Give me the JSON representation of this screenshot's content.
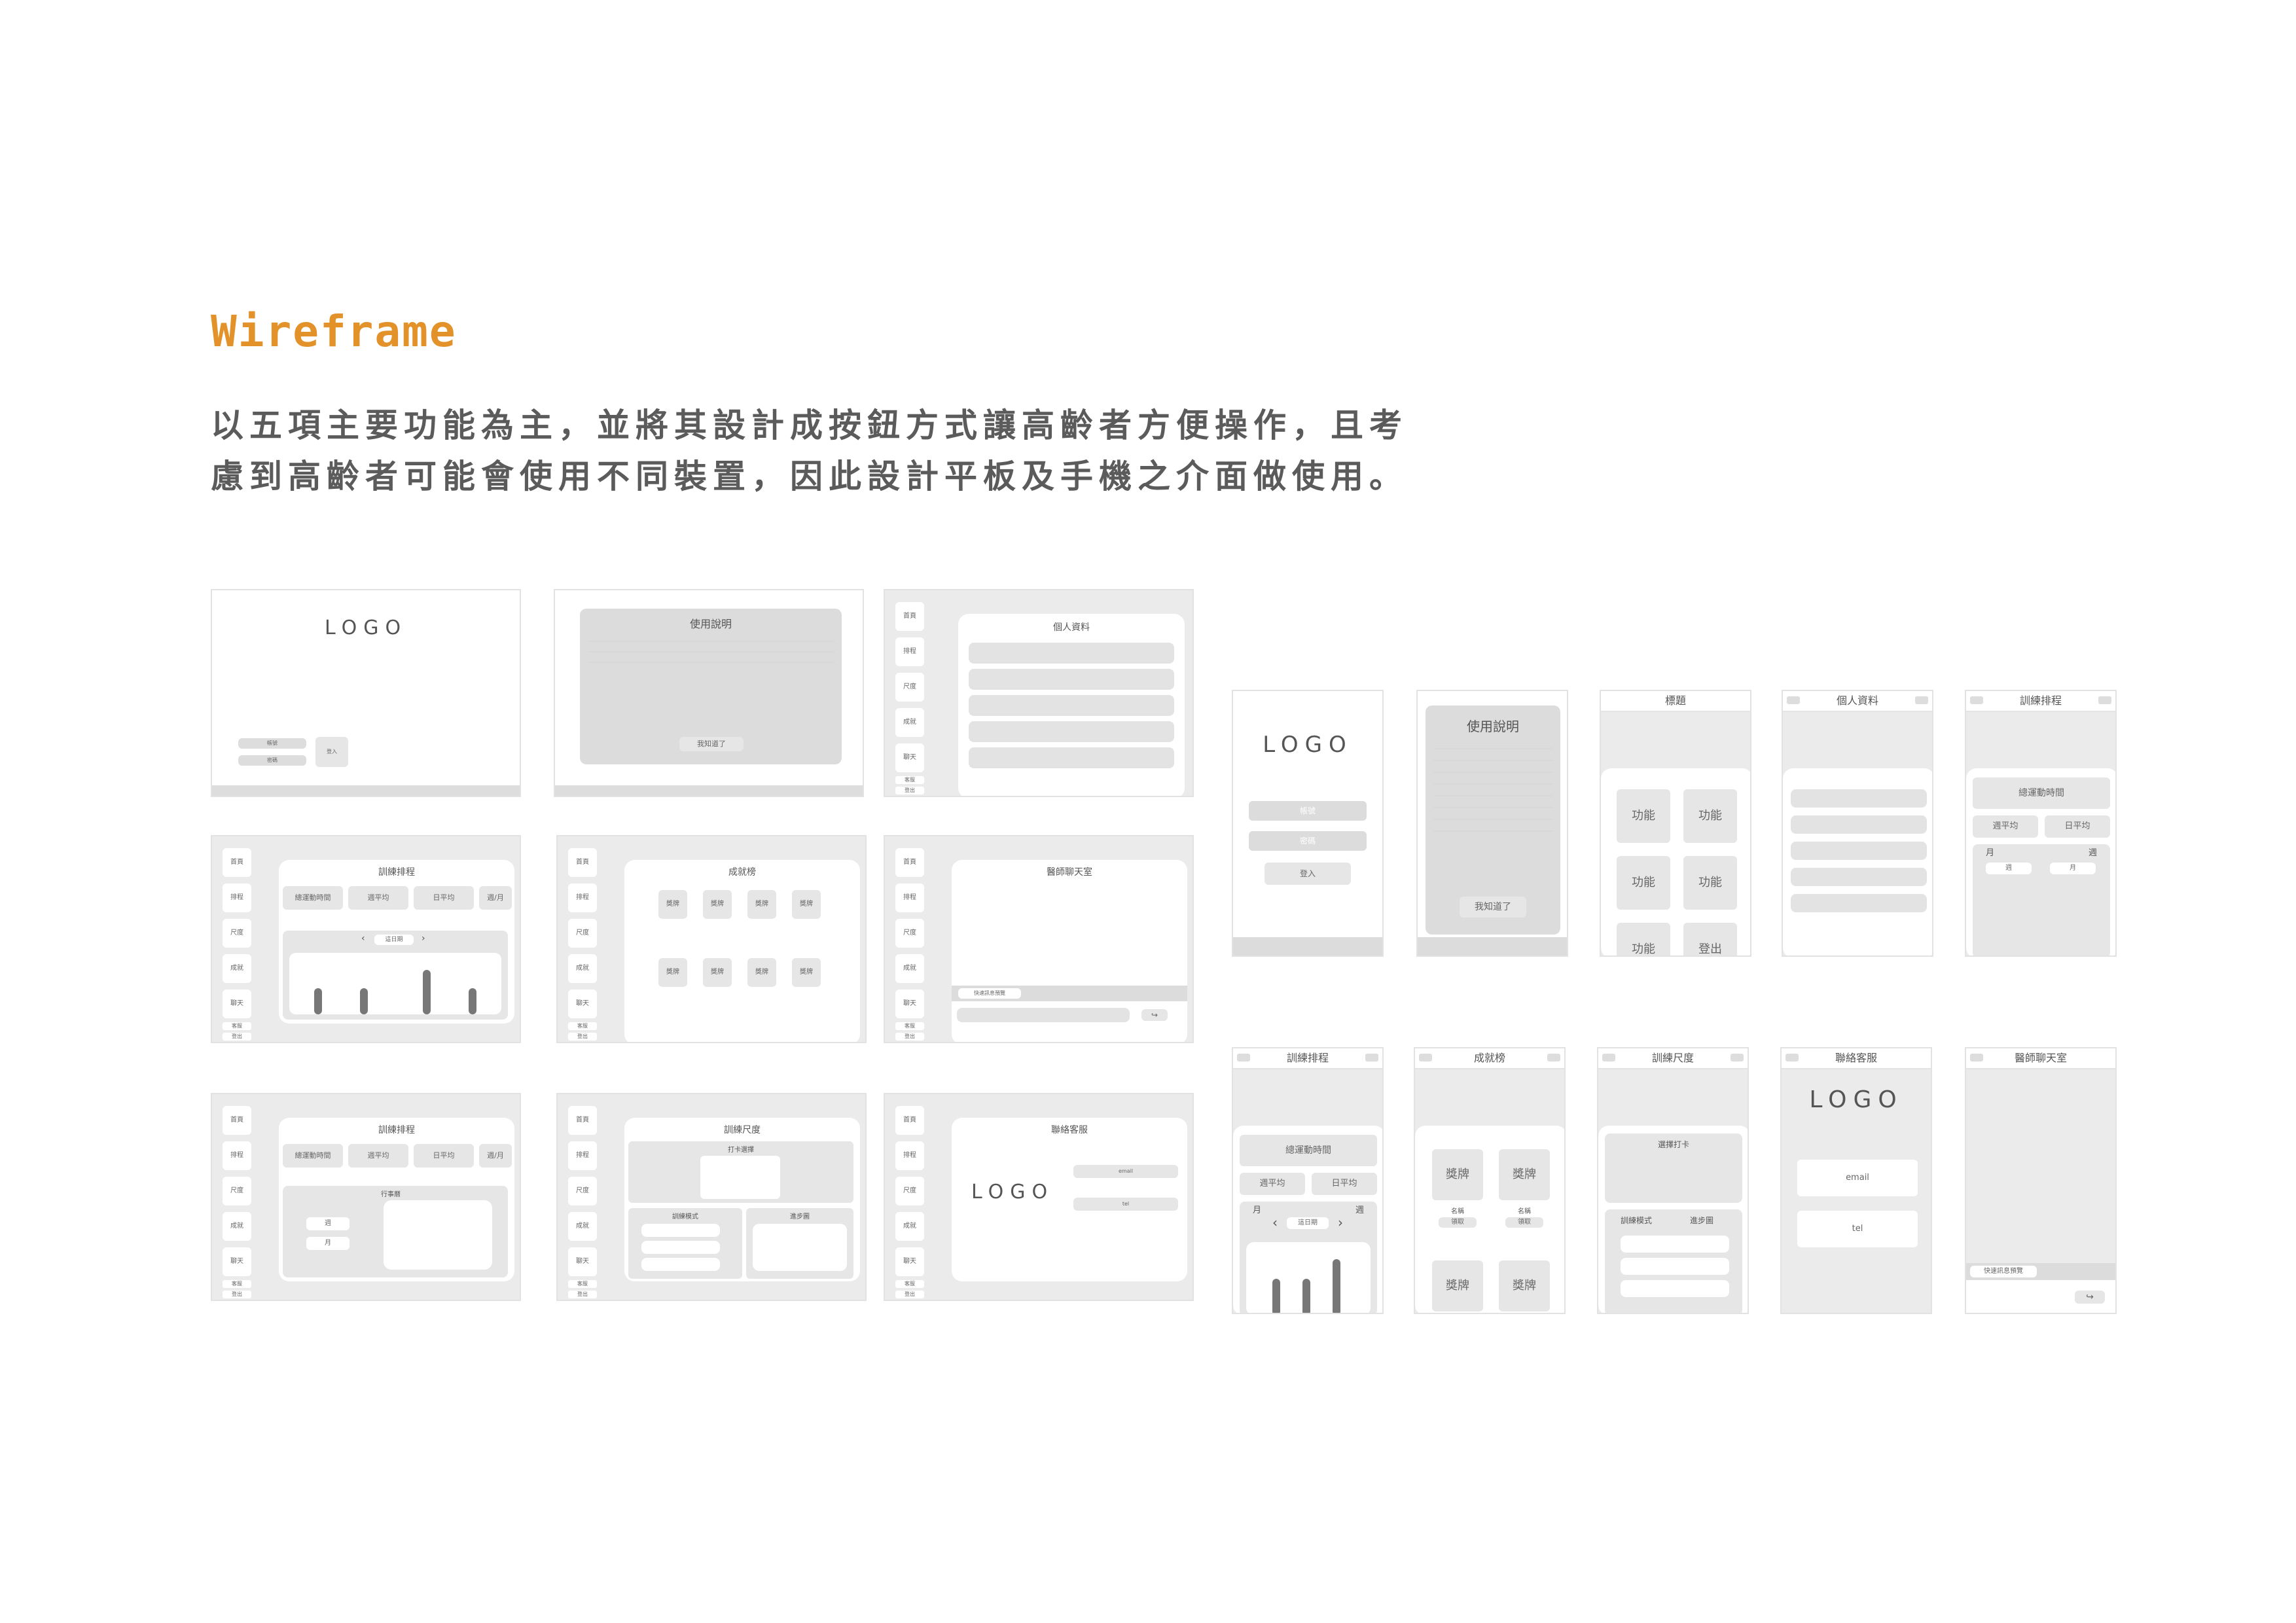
{
  "heading": "Wireframe",
  "description": {
    "line1": "以五項主要功能為主，並將其設計成按鈕方式讓高齡者方便操作，且考",
    "line2": "慮到高齡者可能會使用不同裝置，因此設計平板及手機之介面做使用。"
  },
  "common": {
    "logo": "LOGO",
    "login": "登入",
    "account": "帳號",
    "password": "密碼",
    "got_it": "我知道了",
    "nav": [
      "首頁",
      "排程",
      "尺度",
      "成就",
      "聊天"
    ],
    "nav_small": [
      "客服",
      "登出"
    ],
    "week_selector": "這日期",
    "week": "週",
    "month": "月"
  },
  "screens": {
    "instructions": "使用說明",
    "profile": "個人資料",
    "schedule": "訓練排程",
    "achievements": "成就榜",
    "chat": "醫師聊天室",
    "scale": "訓練尺度",
    "support": "聯絡客服",
    "title": "標題"
  },
  "schedule": {
    "tabs": [
      "總運動時間",
      "週平均",
      "日平均",
      "週/月"
    ],
    "calendar": "行事曆"
  },
  "achievements": {
    "badge": "獎牌",
    "name": "名稱",
    "claim": "領取"
  },
  "scale": {
    "punch_card": "打卡選擇",
    "mode": "訓練模式",
    "progress": "進步圖"
  },
  "chat": {
    "quick_reply": "快速訊息預覽"
  },
  "support": {
    "email": "email",
    "tel": "tel"
  },
  "phone": {
    "function": "功能",
    "logout": "登出",
    "punch_card": "選擇打卡",
    "quick_reply": "快速訊息預覽"
  }
}
